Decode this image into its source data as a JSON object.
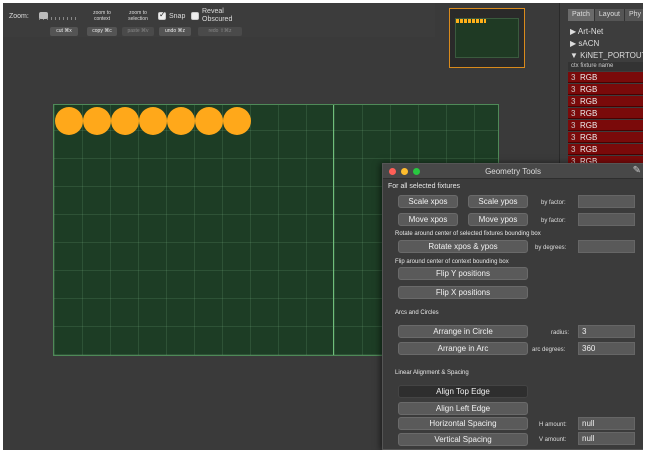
{
  "toolbar": {
    "zoom_label": "Zoom:",
    "zoom_to_context": [
      "zoom to",
      "context"
    ],
    "zoom_to_selection": [
      "zoom to",
      "selection"
    ],
    "snap_label": "Snap",
    "snap_checked": true,
    "reveal_label": [
      "Reveal",
      "Obscured"
    ],
    "reveal_checked": false,
    "cut_label": "cut ⌘x",
    "copy_label": "copy ⌘c",
    "paste_label": "paste ⌘v",
    "undo_label": "undo ⌘z",
    "redo_label": "redo ⇧⌘z"
  },
  "right_panel": {
    "tabs": [
      "Patch",
      "Layout",
      "Phy"
    ],
    "active_tab": "Patch",
    "tree": [
      "▶ Art-Net",
      "▶ sACN",
      "▼ KiNET_PORTOUT"
    ],
    "columns": "ctx  fixture name",
    "fixtures": [
      {
        "ctx": "3",
        "name": "RGB"
      },
      {
        "ctx": "3",
        "name": "RGB"
      },
      {
        "ctx": "3",
        "name": "RGB"
      },
      {
        "ctx": "3",
        "name": "RGB"
      },
      {
        "ctx": "3",
        "name": "RGB"
      },
      {
        "ctx": "3",
        "name": "RGB"
      },
      {
        "ctx": "3",
        "name": "RGB"
      },
      {
        "ctx": "3",
        "name": "RGB"
      }
    ]
  },
  "canvas": {
    "fixture_count": 7,
    "fixture_color": "#ffa81a",
    "background_color": "#1d3d25"
  },
  "geometry_tools": {
    "title": "Geometry Tools",
    "for_all": "For all selected fixtures",
    "scale_xpos": "Scale xpos",
    "scale_ypos": "Scale ypos",
    "by_factor_1": "by factor:",
    "move_xpos": "Move xpos",
    "move_ypos": "Move ypos",
    "by_factor_2": "by factor:",
    "rotate_caption": "Rotate around center of selected fixtures bounding box",
    "rotate_btn": "Rotate xpos & ypos",
    "by_degrees": "by degrees:",
    "flip_caption": "Flip around center of context bounding box",
    "flip_y": "Flip Y positions",
    "flip_x": "Flip X positions",
    "arcs_caption": "Arcs and Circles",
    "arrange_circle": "Arrange in Circle",
    "radius_label": "radius:",
    "radius_value": "3",
    "arrange_arc": "Arrange in Arc",
    "arc_degrees_label": "arc degrees:",
    "arc_degrees_value": "360",
    "linear_caption": "Linear Alignment & Spacing",
    "align_top": "Align Top Edge",
    "align_left": "Align Left Edge",
    "h_spacing": "Horizontal Spacing",
    "h_amount_label": "H amount:",
    "h_amount_value": "null",
    "v_spacing": "Vertical Spacing",
    "v_amount_label": "V amount:",
    "v_amount_value": "null"
  },
  "colors": {
    "accent": "#ffa81a",
    "fixture_row": "#7a0a0a",
    "preview_border": "#d98a1c"
  }
}
